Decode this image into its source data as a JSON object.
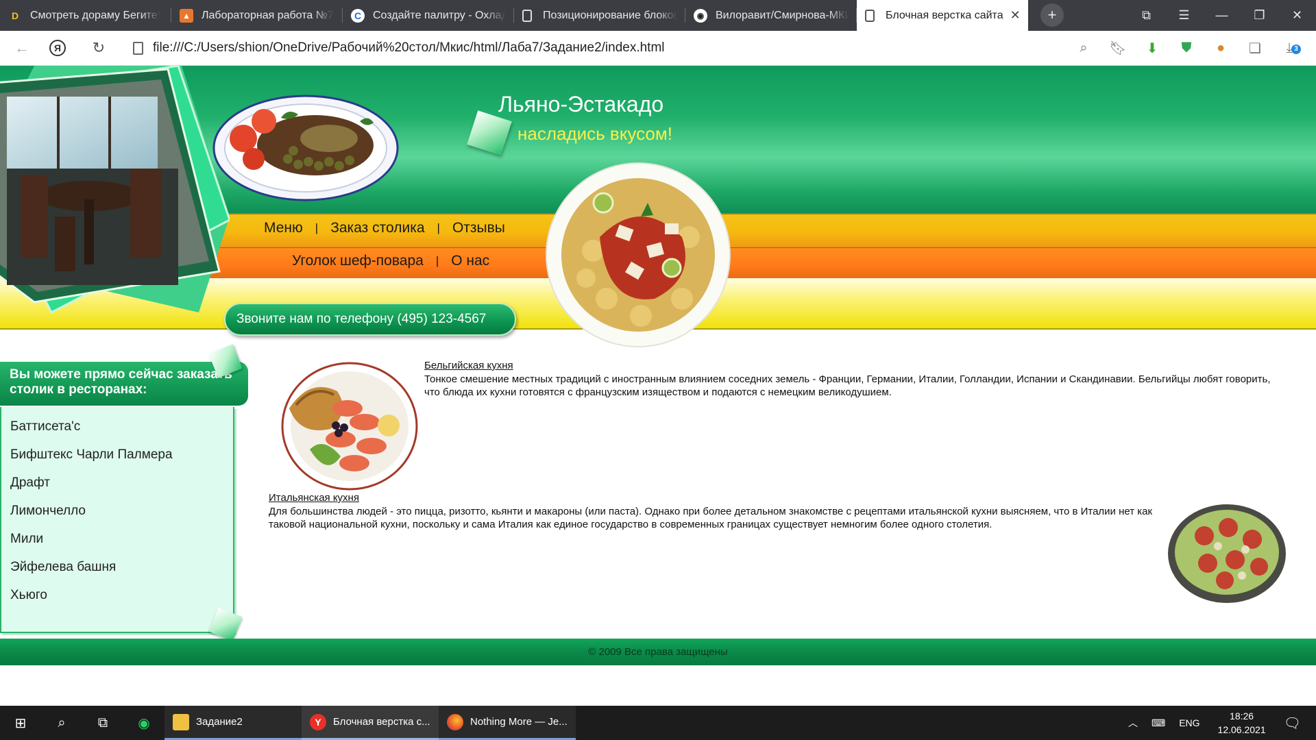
{
  "browser": {
    "tabs": [
      {
        "label": "Смотреть дораму Бегите!",
        "icon": "d-logo-icon"
      },
      {
        "label": "Лабораторная работа №7",
        "icon": "document-orange-icon"
      },
      {
        "label": "Создайте палитру - Охлад",
        "icon": "palette-site-icon"
      },
      {
        "label": "Позиционирование блоков",
        "icon": "page-icon"
      },
      {
        "label": "Вилоравит/Смирнова-МКИС",
        "icon": "github-icon"
      },
      {
        "label": "Блочная верстка сайта",
        "icon": "page-icon",
        "active": true
      }
    ],
    "url": "file:///C:/Users/shion/OneDrive/Рабочий%20стол/Мкис/html/Лаба7/Задание2/index.html",
    "downloads_badge": "3"
  },
  "site": {
    "title": "Льяно-Эстакадо",
    "slogan": "насладись вкусом!",
    "nav_row1": [
      "Меню",
      "Заказ столика",
      "Отзывы"
    ],
    "nav_row2": [
      "Уголок шеф-повара",
      "О нас"
    ],
    "separator": "|",
    "phone": "Звоните нам по телефону (495) 123-4567",
    "sidebar": {
      "heading": "Вы можете прямо сейчас заказать столик в ресторанах:",
      "items": [
        "Баттисета'c",
        "Бифштекс Чарли Палмера",
        "Драфт",
        "Лимончелло",
        "Мили",
        "Эйфелева башня",
        "Хьюго"
      ]
    },
    "articles": [
      {
        "title": "Бельгийская кухня",
        "text": "Тонкое смешение местных традиций с иностранным влиянием соседних земель - Франции, Германии, Италии, Голландии, Испании и Скандинавии. Бельгийцы любят говорить, что блюда их кухни готовятся с французским изяществом и подаются с немецким великодушием."
      },
      {
        "title": "Итальянская кухня",
        "text": "Для большинства людей - это пицца, ризотто, кьянти и макароны (или паста). Однако при более детальном знакомстве с рецептами итальянской кухни выясняем, что в Италии нет как таковой национальной кухни, поскольку и сама Италия как единое государство в современных границах существует немногим более одного столетия."
      }
    ],
    "footer": "© 2009 Все права защищены",
    "colors": {
      "green": "#12a05a",
      "yellow": "#f6b80e",
      "orange": "#ff7a1a",
      "lemon": "#f2e20c",
      "sidebar_bg": "#ddfbee"
    }
  },
  "taskbar": {
    "apps": [
      {
        "label": "Задание2",
        "icon": "folder-icon"
      },
      {
        "label": "Блочная верстка с...",
        "icon": "yandex-browser-icon"
      },
      {
        "label": "Nothing More — Je...",
        "icon": "firefox-icon"
      }
    ],
    "language": "ENG",
    "time": "18:26",
    "date": "12.06.2021"
  }
}
